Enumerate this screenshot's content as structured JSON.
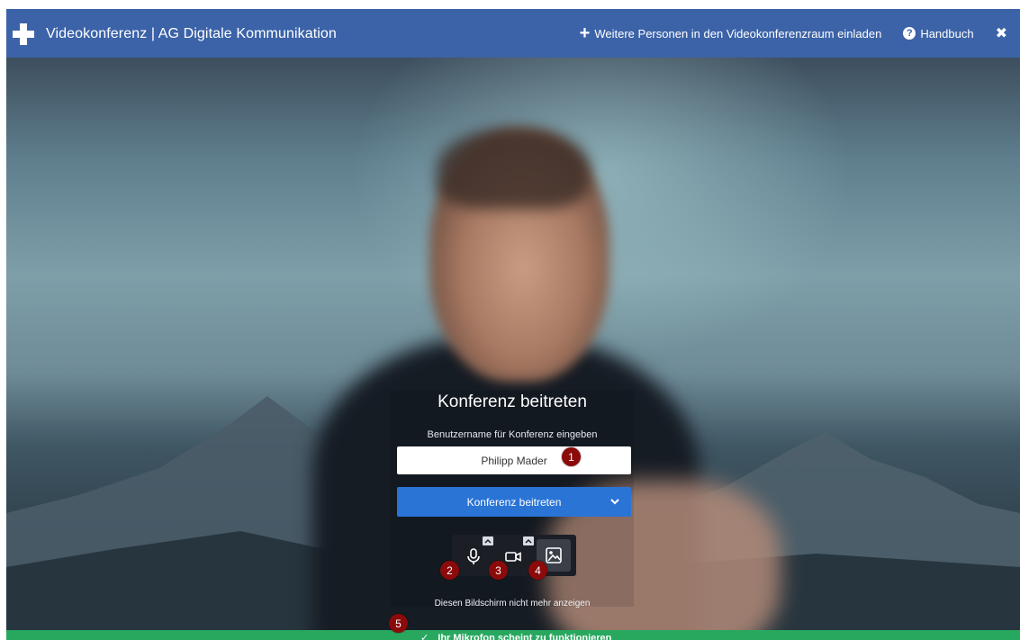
{
  "header": {
    "title": "Videokonferenz | AG Digitale Kommunikation",
    "invite_label": "Weitere Personen in den Videokonferenzraum einladen",
    "manual_label": "Handbuch",
    "icons": [
      "plus-icon",
      "question-circle-icon",
      "close-icon"
    ]
  },
  "prejoin": {
    "title": "Konferenz beitreten",
    "name_label": "Benutzername für Konferenz eingeben",
    "name_value": "Philipp Mader",
    "join_button": "Konferenz beitreten",
    "dont_show_again": "Diesen Bildschirm nicht mehr anzeigen",
    "toolbar_icons": [
      "microphone-icon",
      "camera-icon",
      "background-image-icon"
    ]
  },
  "markers": [
    "1",
    "2",
    "3",
    "4",
    "5"
  ],
  "status": {
    "message": "Ihr Mikrofon scheint zu funktionieren",
    "check": "✓"
  },
  "colors": {
    "header_bg": "#3c63a8",
    "join_button_bg": "#2a74d6",
    "status_bg": "#28a85f",
    "marker_bg": "#8b0a0a"
  }
}
